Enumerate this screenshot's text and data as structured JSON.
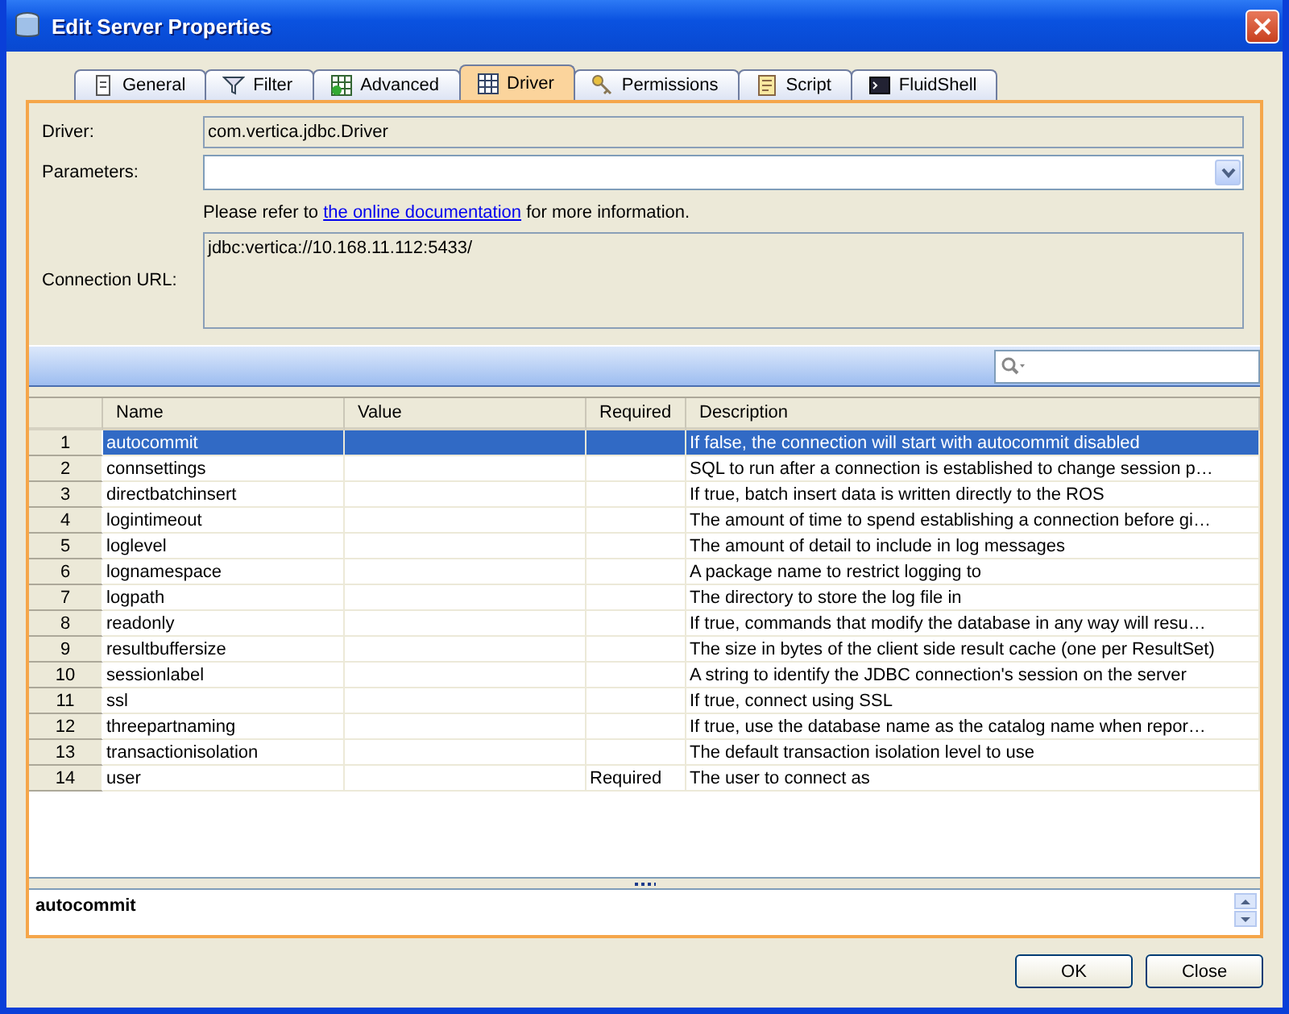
{
  "window": {
    "title": "Edit Server Properties"
  },
  "tabs": [
    {
      "label": "General",
      "selected": false
    },
    {
      "label": "Filter",
      "selected": false
    },
    {
      "label": "Advanced",
      "selected": false
    },
    {
      "label": "Driver",
      "selected": true
    },
    {
      "label": "Permissions",
      "selected": false
    },
    {
      "label": "Script",
      "selected": false
    },
    {
      "label": "FluidShell",
      "selected": false
    }
  ],
  "form": {
    "driver_label": "Driver:",
    "driver_value": "com.vertica.jdbc.Driver",
    "parameters_label": "Parameters:",
    "note_before": "Please refer to ",
    "note_link": "the online documentation",
    "note_after": " for more information.",
    "url_label": "Connection URL:",
    "url_value": "jdbc:vertica://10.168.11.112:5433/"
  },
  "table": {
    "columns": [
      "Name",
      "Value",
      "Required",
      "Description"
    ],
    "rows": [
      {
        "num": "1",
        "name": "autocommit",
        "value": "",
        "required": "",
        "description": "If false, the connection will start with autocommit disabled",
        "selected": true
      },
      {
        "num": "2",
        "name": "connsettings",
        "value": "",
        "required": "",
        "description": "SQL to run after a connection is established to change session p…",
        "selected": false
      },
      {
        "num": "3",
        "name": "directbatchinsert",
        "value": "",
        "required": "",
        "description": "If true, batch insert data is written directly to the ROS",
        "selected": false
      },
      {
        "num": "4",
        "name": "logintimeout",
        "value": "",
        "required": "",
        "description": "The amount of time to spend establishing a connection before gi…",
        "selected": false
      },
      {
        "num": "5",
        "name": "loglevel",
        "value": "",
        "required": "",
        "description": "The amount of detail to include in log messages",
        "selected": false
      },
      {
        "num": "6",
        "name": "lognamespace",
        "value": "",
        "required": "",
        "description": "A package name to restrict logging to",
        "selected": false
      },
      {
        "num": "7",
        "name": "logpath",
        "value": "",
        "required": "",
        "description": "The directory to store the log file in",
        "selected": false
      },
      {
        "num": "8",
        "name": "readonly",
        "value": "",
        "required": "",
        "description": "If true, commands that modify the database in any way will resu…",
        "selected": false
      },
      {
        "num": "9",
        "name": "resultbuffersize",
        "value": "",
        "required": "",
        "description": "The size in bytes of the client side result cache (one per ResultSet)",
        "selected": false
      },
      {
        "num": "10",
        "name": "sessionlabel",
        "value": "",
        "required": "",
        "description": "A string to identify the JDBC connection's session on the server",
        "selected": false
      },
      {
        "num": "11",
        "name": "ssl",
        "value": "",
        "required": "",
        "description": "If true, connect using SSL",
        "selected": false
      },
      {
        "num": "12",
        "name": "threepartnaming",
        "value": "",
        "required": "",
        "description": "If true, use the database name as the catalog name when repor…",
        "selected": false
      },
      {
        "num": "13",
        "name": "transactionisolation",
        "value": "",
        "required": "",
        "description": "The default transaction isolation level to use",
        "selected": false
      },
      {
        "num": "14",
        "name": "user",
        "value": "",
        "required": "Required",
        "description": "The user to connect as",
        "selected": false
      }
    ]
  },
  "detail": {
    "text": "autocommit"
  },
  "buttons": [
    "OK",
    "Close"
  ]
}
